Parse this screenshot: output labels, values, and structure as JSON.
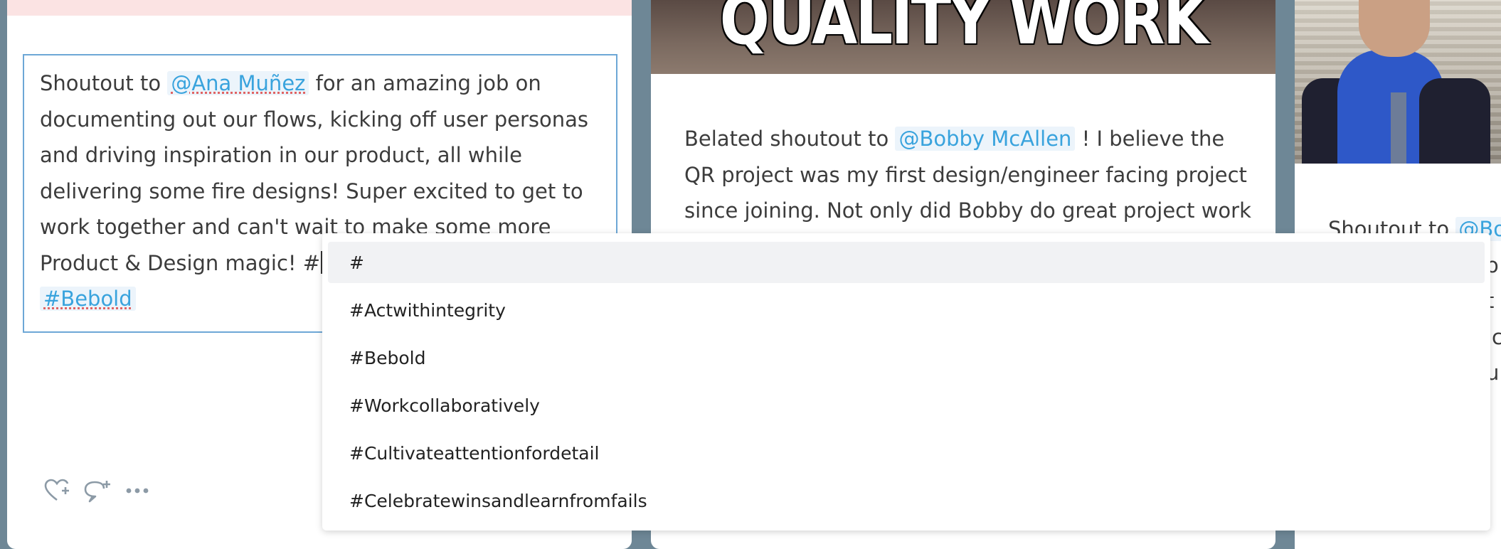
{
  "left_card": {
    "text_before": "Shoutout to ",
    "mention": "@Ana Muñez",
    "text_after": " for an amazing job on documenting out our flows, kicking off user personas and driving inspiration in our product, all while delivering some fire designs! Super excited to get to work together and can't wait to make some more Product & Design magic! #",
    "tag": "#Bebold",
    "icons": [
      "heart-plus-icon",
      "comment-plus-icon",
      "more-icon"
    ]
  },
  "middle_card": {
    "banner_text": "QUALITY WORK",
    "text_before": "Belated shoutout to ",
    "mention": "@Bobby McAllen",
    "text_after": " ! I believe the QR project was my first design/engineer facing project since joining. Not only did Bobby do great project work"
  },
  "right_card": {
    "line1_text": "Shoutout to ",
    "line1_mention": "@Bo",
    "line2": "o",
    "line3": "t",
    "line4": "ic",
    "line5": "u"
  },
  "hashtag_dropdown": {
    "options": [
      "#",
      "#Actwithintegrity",
      "#Bebold",
      "#Workcollaboratively",
      "#Cultivateattentionfordetail",
      "#Celebratewinsandlearnfromfails"
    ],
    "active_index": 0
  },
  "colors": {
    "accent": "#39a3dd",
    "editor_border": "#6da7d6",
    "banner_bg": "#5a4a44"
  }
}
